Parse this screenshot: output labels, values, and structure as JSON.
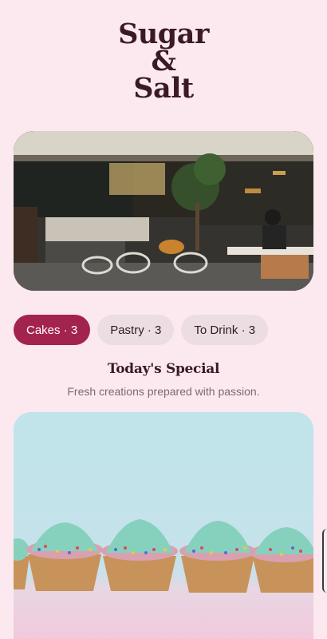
{
  "app": {
    "title_lines": [
      "Sugar",
      "&",
      "Salt"
    ]
  },
  "hero_image": {
    "icon": "cafe-interior-photo"
  },
  "categories": [
    {
      "label": "Cakes · 3",
      "active": true
    },
    {
      "label": "Pastry · 3",
      "active": false
    },
    {
      "label": "To Drink · 3",
      "active": false
    }
  ],
  "special": {
    "title": "Today's Special",
    "subtitle": "Fresh creations prepared with passion."
  },
  "featured_card": {
    "icon": "cupcakes-photo"
  },
  "colors": {
    "background": "#fbe9ef",
    "accent": "#a3234f",
    "chip_inactive": "#ecdde2",
    "title": "#3b1a24"
  }
}
